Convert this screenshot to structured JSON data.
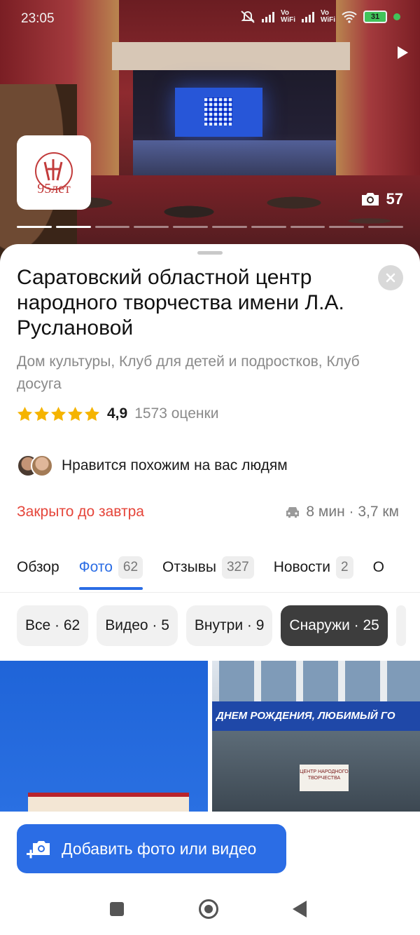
{
  "status_bar": {
    "time": "23:05",
    "vo_wifi_1": "Vo\nWiFi",
    "vo_wifi_2": "Vo\nWiFi",
    "battery": "31"
  },
  "hero": {
    "photo_count": "57",
    "logo_text": "95лет"
  },
  "place": {
    "title": "Саратовский областной центр народного творчества имени Л.А. Руслановой",
    "category": "Дом культуры, Клуб для детей и подростков, Клуб досуга",
    "rating": "4,9",
    "rating_stars": 5,
    "rating_count": "1573 оценки",
    "likes_text": "Нравится похожим на вас людям",
    "hours": "Закрыто до завтра",
    "route": "8 мин · 3,7 км"
  },
  "tabs": [
    {
      "label": "Обзор",
      "badge": ""
    },
    {
      "label": "Фото",
      "badge": "62"
    },
    {
      "label": "Отзывы",
      "badge": "327"
    },
    {
      "label": "Новости",
      "badge": "2"
    },
    {
      "label": "О",
      "badge": ""
    }
  ],
  "chips": [
    {
      "label": "Все · 62"
    },
    {
      "label": "Видео · 5"
    },
    {
      "label": "Внутри · 9"
    },
    {
      "label": "Снаружи · 25"
    }
  ],
  "photos": {
    "banner_text": "ДНЕМ РОЖДЕНИЯ, ЛЮБИМЫЙ ГО",
    "sign_text": "ЦЕНТР НАРОДНОГО ТВОРЧЕСТВА"
  },
  "actions": {
    "add_media": "Добавить фото или видео"
  },
  "colors": {
    "accent": "#2b6de5",
    "closed": "#e5453a",
    "star": "#f5b400"
  }
}
